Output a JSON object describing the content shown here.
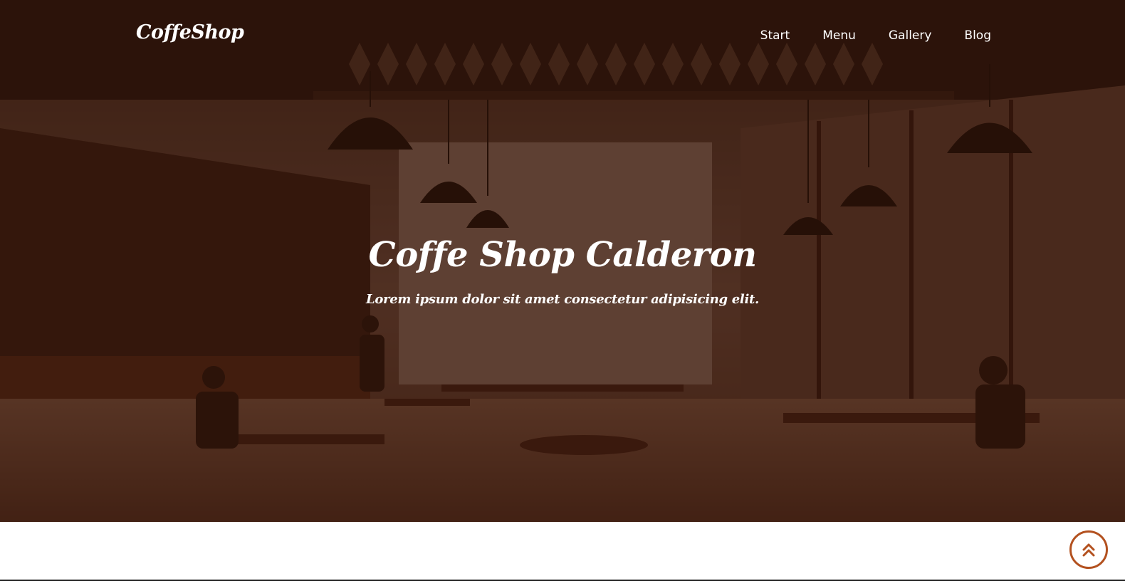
{
  "header": {
    "logo": "CoffeShop",
    "nav": [
      {
        "label": "Start"
      },
      {
        "label": "Menu"
      },
      {
        "label": "Gallery"
      },
      {
        "label": "Blog"
      }
    ]
  },
  "hero": {
    "title": "Coffe Shop Calderon",
    "subtitle": "Lorem ipsum dolor sit amet consectetur adipisicing elit."
  },
  "scroll_top": {
    "icon": "double-chevron-up-icon"
  },
  "colors": {
    "overlay": "#2d1208",
    "accent": "#b3511f",
    "text": "#ffffff"
  }
}
